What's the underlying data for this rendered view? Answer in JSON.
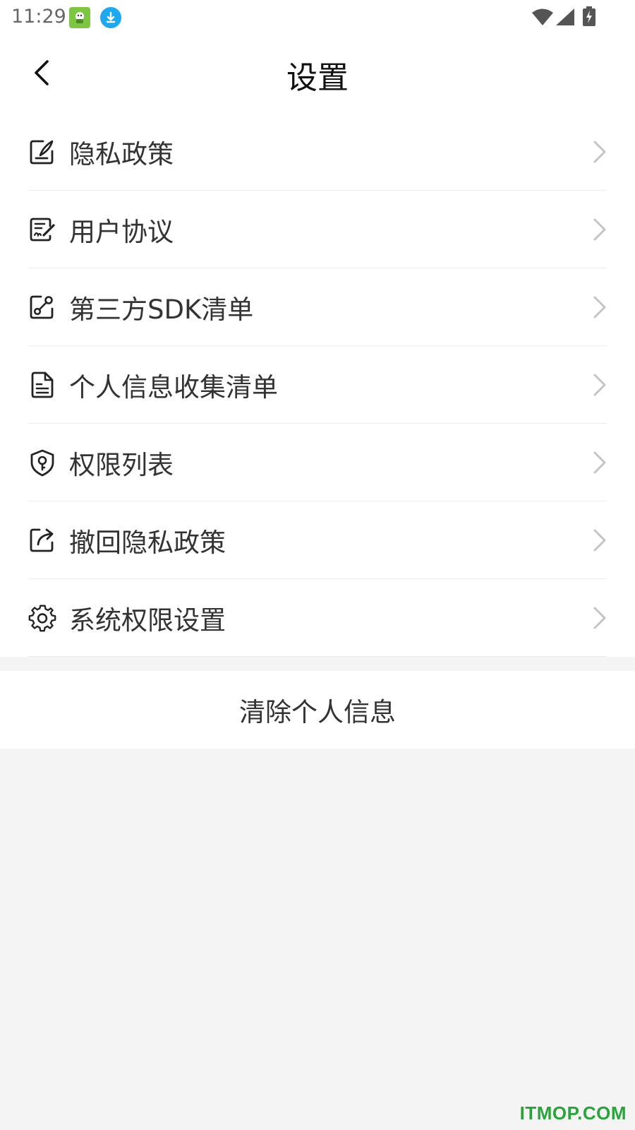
{
  "status_bar": {
    "time": "11:29",
    "icons": [
      "app-notification-icon",
      "download-icon",
      "wifi-icon",
      "signal-icon",
      "battery-charging-icon"
    ]
  },
  "header": {
    "title": "设置",
    "back_icon": "chevron-left-icon"
  },
  "menu": {
    "items": [
      {
        "label": "隐私政策",
        "icon": "document-pen-icon"
      },
      {
        "label": "用户协议",
        "icon": "contract-icon"
      },
      {
        "label": "第三方SDK清单",
        "icon": "share-nodes-icon"
      },
      {
        "label": "个人信息收集清单",
        "icon": "file-list-icon"
      },
      {
        "label": "权限列表",
        "icon": "shield-key-icon"
      },
      {
        "label": "撤回隐私政策",
        "icon": "export-icon"
      },
      {
        "label": "系统权限设置",
        "icon": "gear-icon"
      }
    ]
  },
  "clear_button": {
    "label": "清除个人信息"
  },
  "watermark": "ITMOP.COM",
  "colors": {
    "background": "#f4f4f4",
    "surface": "#ffffff",
    "text": "#333333",
    "divider": "#ececec",
    "chevron": "#c4c4c4",
    "watermark": "#2aa43a"
  }
}
